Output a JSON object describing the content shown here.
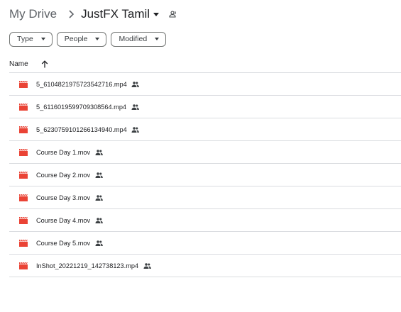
{
  "breadcrumb": {
    "root": "My Drive",
    "separator_icon": "chevron-right-icon",
    "current": "JustFX Tamil",
    "current_dropdown_icon": "caret-down-icon",
    "shared_icon": "shared-folder-icon"
  },
  "filters": [
    {
      "label": "Type",
      "icon": "caret-down-icon"
    },
    {
      "label": "People",
      "icon": "caret-down-icon"
    },
    {
      "label": "Modified",
      "icon": "caret-down-icon"
    }
  ],
  "table_header": {
    "name_label": "Name",
    "sort_icon": "arrow-up-icon"
  },
  "files": [
    {
      "name": "5_6104821975723542716.mp4",
      "icon": "video-file-icon",
      "shared": true
    },
    {
      "name": "5_6116019599709308564.mp4",
      "icon": "video-file-icon",
      "shared": true
    },
    {
      "name": "5_6230759101266134940.mp4",
      "icon": "video-file-icon",
      "shared": true
    },
    {
      "name": "Course Day 1.mov",
      "icon": "video-file-icon",
      "shared": true
    },
    {
      "name": "Course Day 2.mov",
      "icon": "video-file-icon",
      "shared": true
    },
    {
      "name": "Course Day 3.mov",
      "icon": "video-file-icon",
      "shared": true
    },
    {
      "name": "Course Day 4.mov",
      "icon": "video-file-icon",
      "shared": true
    },
    {
      "name": "Course Day 5.mov",
      "icon": "video-file-icon",
      "shared": true
    },
    {
      "name": "InShot_20221219_142738123.mp4",
      "icon": "video-file-icon",
      "shared": true
    }
  ],
  "colors": {
    "video_icon": "#ea4335",
    "divider": "#dadce0",
    "text_primary": "#202124",
    "text_secondary": "#5f6368",
    "chip_border": "#747775"
  }
}
